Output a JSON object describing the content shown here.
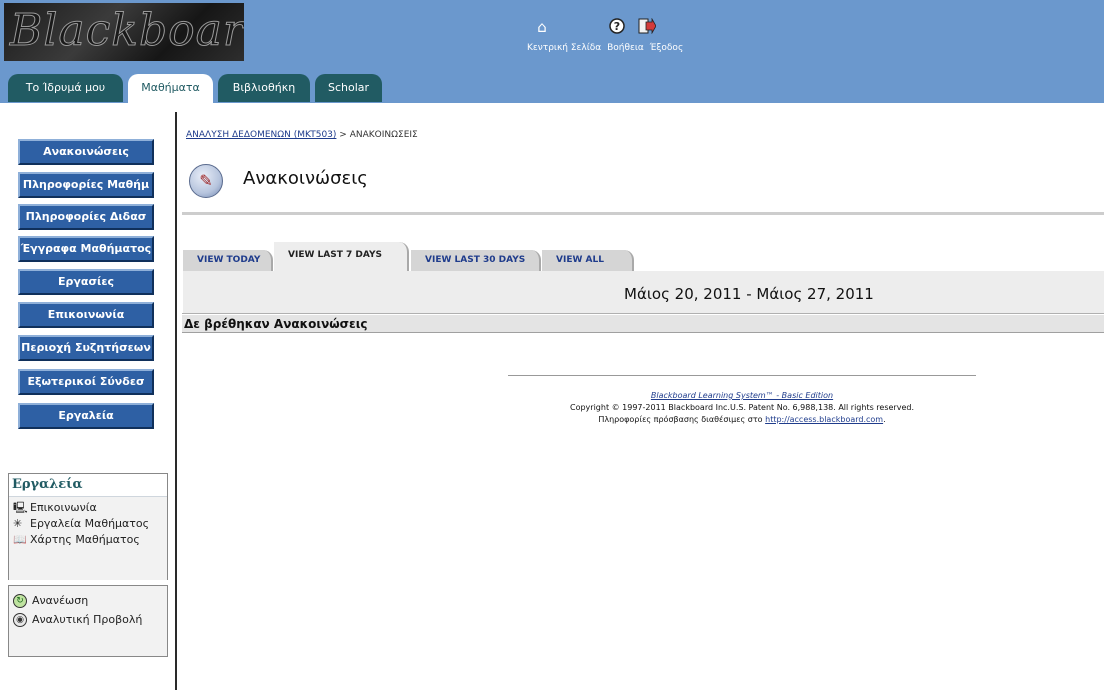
{
  "header": {
    "logo_text": "Blackboard",
    "topnav": {
      "home_icon": "home-icon",
      "help_icon": "help-icon",
      "exit_icon": "exit-icon",
      "home_label": "Κεντρική Σελίδα",
      "help_label": "Βοήθεια",
      "exit_label": "Έξοδος"
    },
    "tabs": [
      {
        "label": "Το Ίδρυμά μου"
      },
      {
        "label": "Μαθήματα"
      },
      {
        "label": "Βιβλιοθήκη"
      },
      {
        "label": "Scholar"
      }
    ],
    "active_tab": "Μαθήματα"
  },
  "sidebar": {
    "buttons": [
      {
        "label": "Ανακοινώσεις"
      },
      {
        "label": "Πληροφορίες Μαθήμ"
      },
      {
        "label": "Πληροφορίες Διδασ"
      },
      {
        "label": "Έγγραφα Μαθήματος"
      },
      {
        "label": "Εργασίες"
      },
      {
        "label": "Επικοινωνία"
      },
      {
        "label": "Περιοχή Συζητήσεων"
      },
      {
        "label": "Εξωτερικοί Σύνδεσ"
      },
      {
        "label": "Εργαλεία"
      }
    ],
    "tools_box": {
      "title": "Εργαλεία",
      "items": [
        {
          "label": "Επικοινωνία",
          "icon": "communication-icon"
        },
        {
          "label": "Εργαλεία Μαθήματος",
          "icon": "course-tools-icon"
        },
        {
          "label": "Χάρτης Μαθήματος",
          "icon": "course-map-icon"
        }
      ]
    },
    "actions": [
      {
        "label": "Ανανέωση",
        "icon": "refresh-icon"
      },
      {
        "label": "Αναλυτική Προβολή",
        "icon": "detail-view-icon"
      }
    ]
  },
  "main": {
    "breadcrumb": {
      "course": "ΑΝΑΛΥΣΗ ΔΕΔΟΜΕΝΩΝ (MKT503)",
      "separator": ">",
      "current": "ΑΝΑΚΟΙΝΩΣΕΙΣ"
    },
    "page_title": "Ανακοινώσεις",
    "page_icon": "announcements-icon",
    "view_tabs": [
      {
        "label": "VIEW TODAY"
      },
      {
        "label": "VIEW LAST 7 DAYS"
      },
      {
        "label": "VIEW LAST 30 DAYS"
      },
      {
        "label": "VIEW ALL"
      }
    ],
    "active_view": "VIEW LAST 7 DAYS",
    "date_range": "Μάιος 20, 2011 - Μάιος 27, 2011",
    "empty_message": "Δε βρέθηκαν Ανακοινώσεις"
  },
  "footer": {
    "product_link": "Blackboard Learning System™ - Basic Edition",
    "copyright": "Copyright © 1997-2011 Blackboard Inc.U.S. Patent No. 6,988,138. All rights reserved.",
    "access_prefix": "Πληροφορίες πρόσβασης διαθέσιμες στο",
    "access_link": "http://access.blackboard.com",
    "access_suffix": "."
  },
  "colors": {
    "header_bg": "#6b98cd",
    "tab_bg": "#215b63",
    "nav_button_bg": "#2e60a4",
    "link": "#1f3c8c"
  }
}
